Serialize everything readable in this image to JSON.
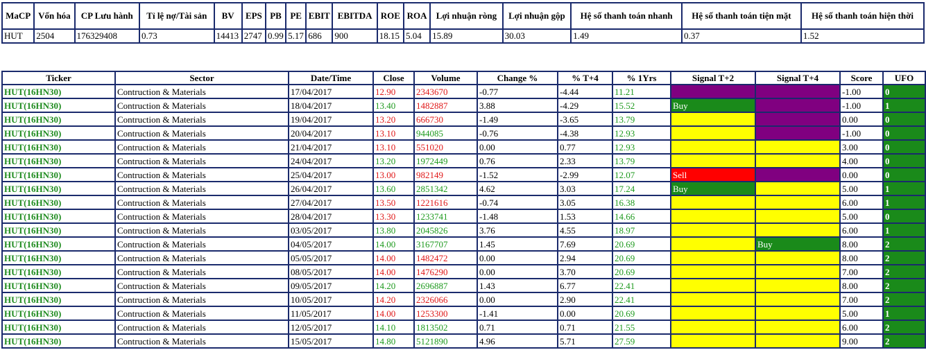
{
  "summary": {
    "headers": [
      "MaCP",
      "Vốn hóa",
      "CP Lưu hành",
      "Tỉ lệ nợ/Tài sản",
      "BV",
      "EPS",
      "PB",
      "PE",
      "EBIT",
      "EBITDA",
      "ROE",
      "ROA",
      "Lợi nhuận ròng",
      "Lợi nhuận gộp",
      "Hệ số thanh toán nhanh",
      "Hệ số thanh toán tiện mặt",
      "Hệ số thanh toán hiện thời"
    ],
    "values": [
      "HUT",
      "2504",
      "176329408",
      "0.73",
      "14413",
      "2747",
      "0.99",
      "5.17",
      "686",
      "900",
      "18.15",
      "5.04",
      "15.89",
      "30.03",
      "1.49",
      "0.37",
      "1.52"
    ]
  },
  "signals": {
    "headers": [
      "Ticker",
      "Sector",
      "Date/Time",
      "Close",
      "Volume",
      "Change %",
      "% T+4",
      "% 1Yrs",
      "Signal T+2",
      "Signal T+4",
      "Score",
      "UFO"
    ],
    "colors": {
      "ticker": "#1e8b1e",
      "up": "#1e9a1e",
      "down": "#e01818",
      "purple": "#800080",
      "yellow": "#ffff00",
      "green": "#1a8a1a",
      "red": "#ff0000",
      "border": "#1a2a6c"
    },
    "rows": [
      {
        "ticker": "HUT(16HN30)",
        "sector": "Contruction & Materials",
        "date": "17/04/2017",
        "close": "12.90",
        "close_dir": "r",
        "volume": "2343670",
        "volume_dir": "r",
        "change": "-0.77",
        "t4": "-4.44",
        "y1": "11.21",
        "sig2": "",
        "sig2_color": "purple",
        "sig4": "",
        "sig4_color": "purple",
        "score": "-1.00",
        "ufo": "0"
      },
      {
        "ticker": "HUT(16HN30)",
        "sector": "Contruction & Materials",
        "date": "18/04/2017",
        "close": "13.40",
        "close_dir": "g",
        "volume": "1482887",
        "volume_dir": "r",
        "change": "3.88",
        "t4": "-4.29",
        "y1": "15.52",
        "sig2": "Buy",
        "sig2_color": "green",
        "sig4": "",
        "sig4_color": "purple",
        "score": "-1.00",
        "ufo": "1"
      },
      {
        "ticker": "HUT(16HN30)",
        "sector": "Contruction & Materials",
        "date": "19/04/2017",
        "close": "13.20",
        "close_dir": "r",
        "volume": "666730",
        "volume_dir": "r",
        "change": "-1.49",
        "t4": "-3.65",
        "y1": "13.79",
        "sig2": "",
        "sig2_color": "yellow",
        "sig4": "",
        "sig4_color": "purple",
        "score": "0.00",
        "ufo": "0"
      },
      {
        "ticker": "HUT(16HN30)",
        "sector": "Contruction & Materials",
        "date": "20/04/2017",
        "close": "13.10",
        "close_dir": "r",
        "volume": "944085",
        "volume_dir": "g",
        "change": "-0.76",
        "t4": "-4.38",
        "y1": "12.93",
        "sig2": "",
        "sig2_color": "yellow",
        "sig4": "",
        "sig4_color": "purple",
        "score": "-1.00",
        "ufo": "0"
      },
      {
        "ticker": "HUT(16HN30)",
        "sector": "Contruction & Materials",
        "date": "21/04/2017",
        "close": "13.10",
        "close_dir": "r",
        "volume": "551020",
        "volume_dir": "r",
        "change": "0.00",
        "t4": "0.77",
        "y1": "12.93",
        "sig2": "",
        "sig2_color": "yellow",
        "sig4": "",
        "sig4_color": "yellow",
        "score": "3.00",
        "ufo": "0"
      },
      {
        "ticker": "HUT(16HN30)",
        "sector": "Contruction & Materials",
        "date": "24/04/2017",
        "close": "13.20",
        "close_dir": "g",
        "volume": "1972449",
        "volume_dir": "g",
        "change": "0.76",
        "t4": "2.33",
        "y1": "13.79",
        "sig2": "",
        "sig2_color": "yellow",
        "sig4": "",
        "sig4_color": "yellow",
        "score": "4.00",
        "ufo": "0"
      },
      {
        "ticker": "HUT(16HN30)",
        "sector": "Contruction & Materials",
        "date": "25/04/2017",
        "close": "13.00",
        "close_dir": "r",
        "volume": "982149",
        "volume_dir": "r",
        "change": "-1.52",
        "t4": "-2.99",
        "y1": "12.07",
        "sig2": "Sell",
        "sig2_color": "red",
        "sig4": "",
        "sig4_color": "purple",
        "score": "0.00",
        "ufo": "0"
      },
      {
        "ticker": "HUT(16HN30)",
        "sector": "Contruction & Materials",
        "date": "26/04/2017",
        "close": "13.60",
        "close_dir": "g",
        "volume": "2851342",
        "volume_dir": "g",
        "change": "4.62",
        "t4": "3.03",
        "y1": "17.24",
        "sig2": "Buy",
        "sig2_color": "green",
        "sig4": "",
        "sig4_color": "yellow",
        "score": "5.00",
        "ufo": "1"
      },
      {
        "ticker": "HUT(16HN30)",
        "sector": "Contruction & Materials",
        "date": "27/04/2017",
        "close": "13.50",
        "close_dir": "r",
        "volume": "1221616",
        "volume_dir": "r",
        "change": "-0.74",
        "t4": "3.05",
        "y1": "16.38",
        "sig2": "",
        "sig2_color": "yellow",
        "sig4": "",
        "sig4_color": "yellow",
        "score": "6.00",
        "ufo": "1"
      },
      {
        "ticker": "HUT(16HN30)",
        "sector": "Contruction & Materials",
        "date": "28/04/2017",
        "close": "13.30",
        "close_dir": "r",
        "volume": "1233741",
        "volume_dir": "g",
        "change": "-1.48",
        "t4": "1.53",
        "y1": "14.66",
        "sig2": "",
        "sig2_color": "yellow",
        "sig4": "",
        "sig4_color": "yellow",
        "score": "5.00",
        "ufo": "0"
      },
      {
        "ticker": "HUT(16HN30)",
        "sector": "Contruction & Materials",
        "date": "03/05/2017",
        "close": "13.80",
        "close_dir": "g",
        "volume": "2045826",
        "volume_dir": "g",
        "change": "3.76",
        "t4": "4.55",
        "y1": "18.97",
        "sig2": "",
        "sig2_color": "yellow",
        "sig4": "",
        "sig4_color": "yellow",
        "score": "6.00",
        "ufo": "1"
      },
      {
        "ticker": "HUT(16HN30)",
        "sector": "Contruction & Materials",
        "date": "04/05/2017",
        "close": "14.00",
        "close_dir": "g",
        "volume": "3167707",
        "volume_dir": "g",
        "change": "1.45",
        "t4": "7.69",
        "y1": "20.69",
        "sig2": "",
        "sig2_color": "yellow",
        "sig4": "Buy",
        "sig4_color": "green",
        "score": "8.00",
        "ufo": "2"
      },
      {
        "ticker": "HUT(16HN30)",
        "sector": "Contruction & Materials",
        "date": "05/05/2017",
        "close": "14.00",
        "close_dir": "r",
        "volume": "1482472",
        "volume_dir": "r",
        "change": "0.00",
        "t4": "2.94",
        "y1": "20.69",
        "sig2": "",
        "sig2_color": "yellow",
        "sig4": "",
        "sig4_color": "yellow",
        "score": "8.00",
        "ufo": "2"
      },
      {
        "ticker": "HUT(16HN30)",
        "sector": "Contruction & Materials",
        "date": "08/05/2017",
        "close": "14.00",
        "close_dir": "r",
        "volume": "1476290",
        "volume_dir": "r",
        "change": "0.00",
        "t4": "3.70",
        "y1": "20.69",
        "sig2": "",
        "sig2_color": "yellow",
        "sig4": "",
        "sig4_color": "yellow",
        "score": "7.00",
        "ufo": "2"
      },
      {
        "ticker": "HUT(16HN30)",
        "sector": "Contruction & Materials",
        "date": "09/05/2017",
        "close": "14.20",
        "close_dir": "g",
        "volume": "2696887",
        "volume_dir": "g",
        "change": "1.43",
        "t4": "6.77",
        "y1": "22.41",
        "sig2": "",
        "sig2_color": "yellow",
        "sig4": "",
        "sig4_color": "yellow",
        "score": "8.00",
        "ufo": "2"
      },
      {
        "ticker": "HUT(16HN30)",
        "sector": "Contruction & Materials",
        "date": "10/05/2017",
        "close": "14.20",
        "close_dir": "r",
        "volume": "2326066",
        "volume_dir": "r",
        "change": "0.00",
        "t4": "2.90",
        "y1": "22.41",
        "sig2": "",
        "sig2_color": "yellow",
        "sig4": "",
        "sig4_color": "yellow",
        "score": "7.00",
        "ufo": "2"
      },
      {
        "ticker": "HUT(16HN30)",
        "sector": "Contruction & Materials",
        "date": "11/05/2017",
        "close": "14.00",
        "close_dir": "r",
        "volume": "1253300",
        "volume_dir": "r",
        "change": "-1.41",
        "t4": "0.00",
        "y1": "20.69",
        "sig2": "",
        "sig2_color": "yellow",
        "sig4": "",
        "sig4_color": "yellow",
        "score": "5.00",
        "ufo": "1"
      },
      {
        "ticker": "HUT(16HN30)",
        "sector": "Contruction & Materials",
        "date": "12/05/2017",
        "close": "14.10",
        "close_dir": "g",
        "volume": "1813502",
        "volume_dir": "g",
        "change": "0.71",
        "t4": "0.71",
        "y1": "21.55",
        "sig2": "",
        "sig2_color": "yellow",
        "sig4": "",
        "sig4_color": "yellow",
        "score": "6.00",
        "ufo": "2"
      },
      {
        "ticker": "HUT(16HN30)",
        "sector": "Contruction & Materials",
        "date": "15/05/2017",
        "close": "14.80",
        "close_dir": "g",
        "volume": "5121890",
        "volume_dir": "g",
        "change": "4.96",
        "t4": "5.71",
        "y1": "27.59",
        "sig2": "",
        "sig2_color": "yellow",
        "sig4": "",
        "sig4_color": "yellow",
        "score": "9.00",
        "ufo": "2"
      }
    ]
  }
}
